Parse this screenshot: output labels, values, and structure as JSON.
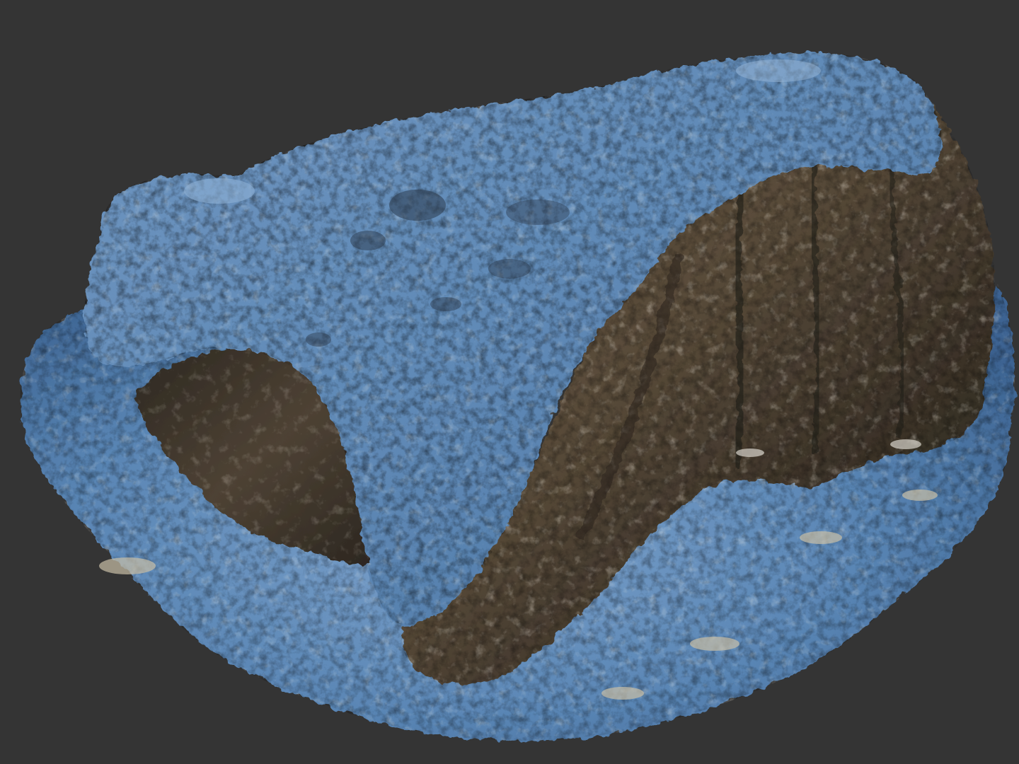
{
  "viewport": {
    "background_color": "#343434",
    "subject": "rock-scan-mesh"
  },
  "colors": {
    "ground_light": "#9ab8d8",
    "ground_mid": "#5a86b5",
    "ground_dark": "#2e4f78",
    "rock_top_light": "#8fb1d6",
    "rock_top_mid": "#5c85b2",
    "rock_side_dark": "#2a2620",
    "rock_side_mid": "#5a4c3a",
    "rock_side_highlight": "#a3927a",
    "sand_highlight": "#c9bfa6"
  }
}
